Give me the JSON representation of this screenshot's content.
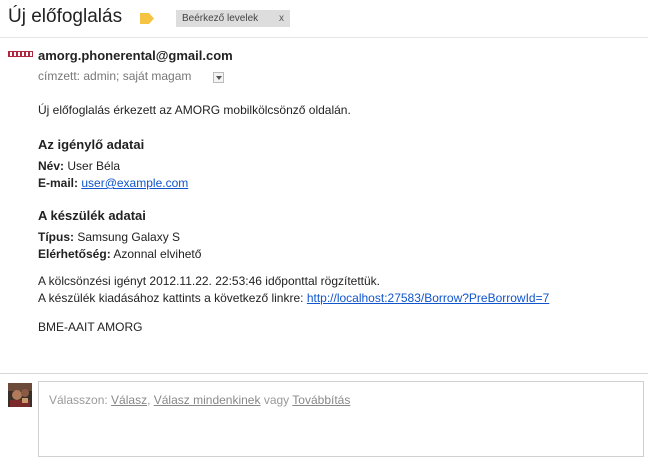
{
  "header": {
    "subject": "Új előfoglalás",
    "label_chip": "Beérkező levelek",
    "label_chip_close": "x"
  },
  "message": {
    "sender": "amorg.phonerental@gmail.com",
    "recipients": "címzett: admin; saját magam",
    "intro": "Új előfoglalás érkezett az AMORG mobilkölcsönző oldalán.",
    "requester_heading": "Az igénylő adatai",
    "name_label": "Név:",
    "name_value": " User Béla",
    "email_label": "E-mail:",
    "email_value": "user@example.com",
    "device_heading": "A készülék adatai",
    "type_label": "Típus:",
    "type_value": " Samsung Galaxy S",
    "availability_label": "Elérhetőség:",
    "availability_value": " Azonnal elvihető",
    "recorded_line": "A kölcsönzési igényt 2012.11.22. 22:53:46 időponttal rögzítettük.",
    "pickup_prefix": "A készülék kiadásához kattints a következő linkre: ",
    "pickup_link": "http://localhost:27583/Borrow?PreBorrowId=7",
    "signature": "BME-AAIT AMORG"
  },
  "reply": {
    "prefix": "Válasszon: ",
    "reply": "Válasz",
    "sep": ", ",
    "reply_all": "Válasz mindenkinek",
    "or": " vagy ",
    "forward": "Továbbítás"
  },
  "colors": {
    "link": "#1155cc",
    "label_tag": "#f6c443",
    "chip_bg": "#dddddd"
  },
  "icons": {
    "label_tag": "label-tag-icon",
    "sender_logo": "sender-logo-icon",
    "dropdown": "chevron-down-icon",
    "avatar": "avatar"
  }
}
